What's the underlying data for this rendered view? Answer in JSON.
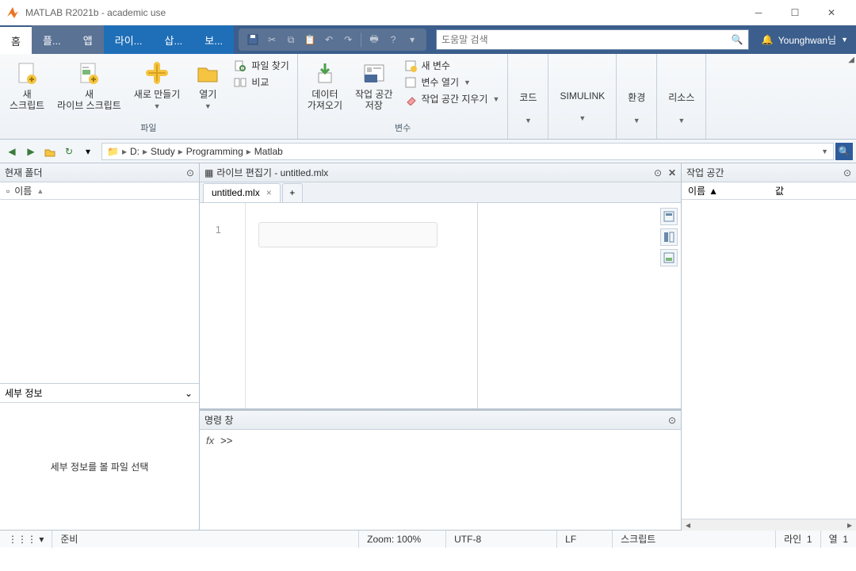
{
  "titlebar": {
    "title": "MATLAB R2021b - academic use"
  },
  "tabs": {
    "home": "홈",
    "plot": "플...",
    "apps": "앱",
    "live": "라이...",
    "insert": "삽...",
    "view": "보..."
  },
  "search": {
    "placeholder": "도움말 검색"
  },
  "user": {
    "name": "Younghwan님"
  },
  "ribbon": {
    "group_file": "파일",
    "group_var": "변수",
    "new_script": "새\n스크립트",
    "new_live": "새\n라이브 스크립트",
    "new": "새로 만들기",
    "open": "열기",
    "find_files": "파일 찾기",
    "compare": "비교",
    "import": "데이터\n가져오기",
    "save_ws": "작업 공간\n저장",
    "new_var": "새 변수",
    "open_var": "변수 열기",
    "clear_ws": "작업 공간 지우기",
    "code": "코드",
    "simulink": "SIMULINK",
    "env": "환경",
    "resources": "리소스"
  },
  "breadcrumb": {
    "drive": "D:",
    "p1": "Study",
    "p2": "Programming",
    "p3": "Matlab"
  },
  "panels": {
    "current_folder": "현재 폴더",
    "name": "이름",
    "value": "값",
    "details": "세부 정보",
    "details_hint": "세부 정보를 볼 파일 선택",
    "live_editor": "라이브 편집기 - untitled.mlx",
    "tab_file": "untitled.mlx",
    "command_window": "명령 창",
    "prompt": ">>",
    "workspace": "작업 공간"
  },
  "status": {
    "ready": "준비",
    "zoom": "Zoom: 100%",
    "encoding": "UTF-8",
    "eol": "LF",
    "mode": "스크립트",
    "line_label": "라인",
    "line": "1",
    "col_label": "열",
    "col": "1"
  }
}
